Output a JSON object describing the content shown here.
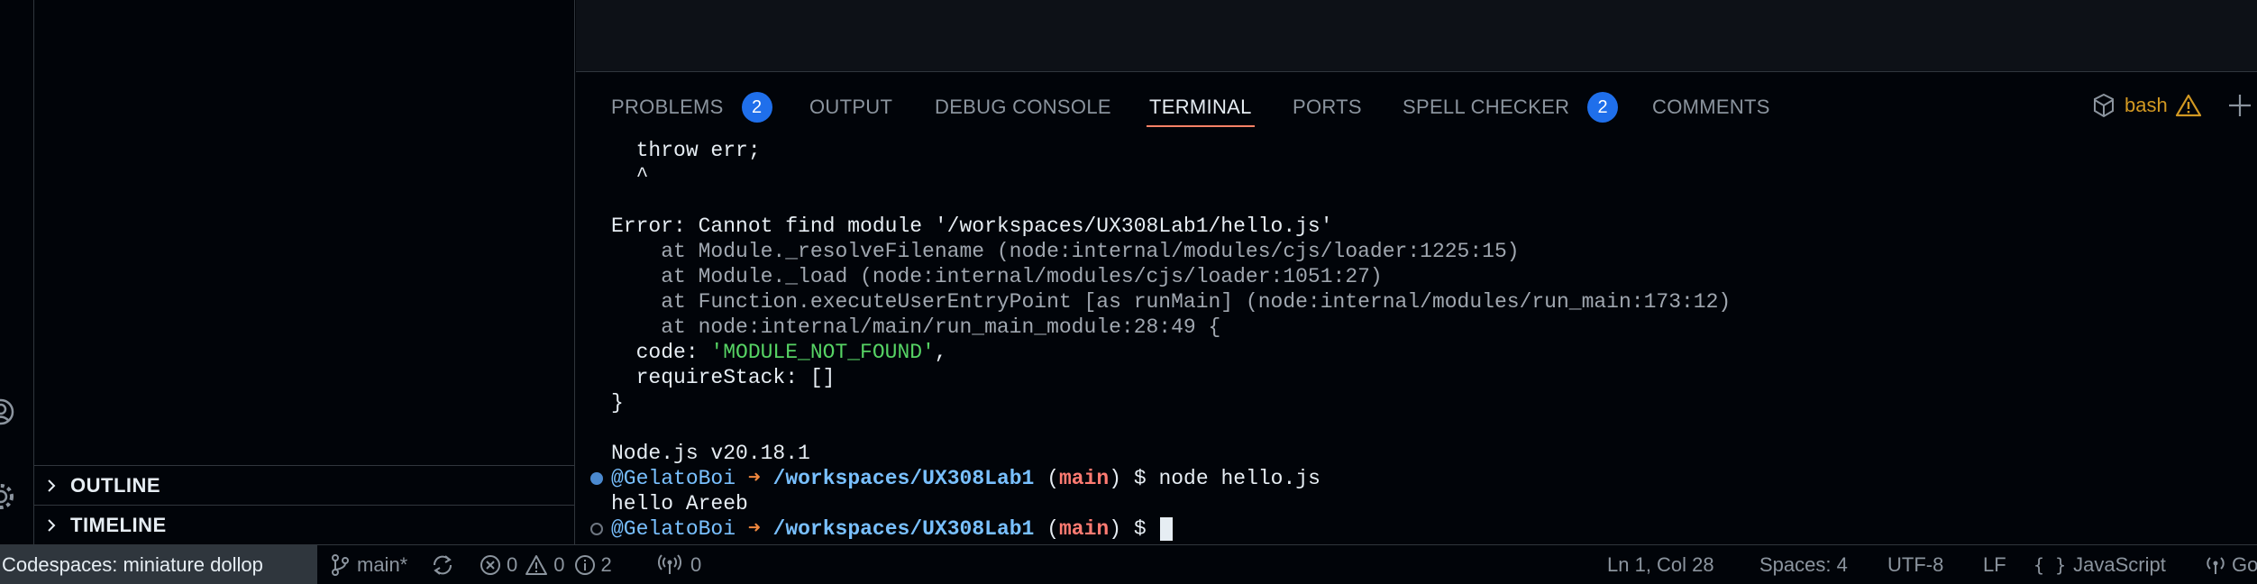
{
  "sidebar": {
    "sections": [
      {
        "label": "OUTLINE"
      },
      {
        "label": "TIMELINE"
      }
    ]
  },
  "panel": {
    "tabs": [
      {
        "label": "PROBLEMS",
        "badge": "2"
      },
      {
        "label": "OUTPUT"
      },
      {
        "label": "DEBUG CONSOLE"
      },
      {
        "label": "TERMINAL",
        "active": true
      },
      {
        "label": "PORTS"
      },
      {
        "label": "SPELL CHECKER",
        "badge": "2"
      },
      {
        "label": "COMMENTS"
      }
    ],
    "terminal_name": "bash"
  },
  "terminal": {
    "lines": [
      "  throw err;",
      "  ^",
      "",
      "Error: Cannot find module '/workspaces/UX308Lab1/hello.js'",
      "    at Module._resolveFilename (node:internal/modules/cjs/loader:1225:15)",
      "    at Module._load (node:internal/modules/cjs/loader:1051:27)",
      "    at Function.executeUserEntryPoint [as runMain] (node:internal/modules/run_main:173:12)",
      "    at node:internal/main/run_main_module:28:49 {"
    ],
    "code_key": "  code: ",
    "code_value": "'MODULE_NOT_FOUND'",
    "code_comma": ",",
    "require_stack": "  requireStack: []",
    "close_brace": "}",
    "node_version": "Node.js v20.18.1",
    "prompt_user": "@GelatoBoi",
    "prompt_arrow": "➜",
    "prompt_path": "/workspaces/UX308Lab1",
    "prompt_branch": "main",
    "command": "$ node hello.js",
    "output": "hello Areeb",
    "prompt_end": "$"
  },
  "statusbar": {
    "remote": "Codespaces: miniature dollop",
    "branch": "main*",
    "errors": "0",
    "warnings": "0",
    "info": "2",
    "ports": "0",
    "position": "Ln 1, Col 28",
    "spaces": "Spaces: 4",
    "encoding": "UTF-8",
    "eol": "LF",
    "language": "JavaScript",
    "go_live": "Go"
  },
  "colors": {
    "accent": "#1f6feb",
    "active_tab_underline": "#f78166",
    "warning": "#d29922",
    "string": "#56d364",
    "branch": "#ff7b72"
  }
}
